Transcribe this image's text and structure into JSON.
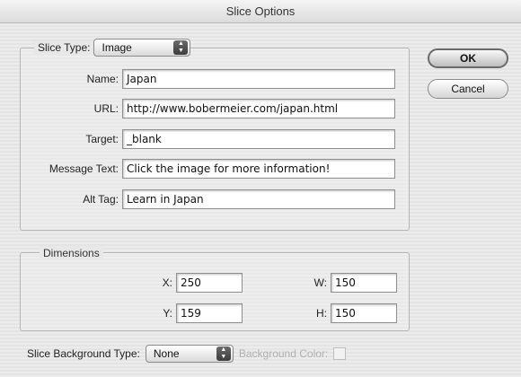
{
  "window": {
    "title": "Slice Options"
  },
  "slice_type": {
    "label": "Slice Type:",
    "value": "Image"
  },
  "fields": {
    "name": {
      "label": "Name:",
      "value": "Japan"
    },
    "url": {
      "label": "URL:",
      "value": "http://www.bobermeier.com/japan.html"
    },
    "target": {
      "label": "Target:",
      "value": "_blank"
    },
    "message": {
      "label": "Message Text:",
      "value": "Click the image for more information!"
    },
    "alt": {
      "label": "Alt Tag:",
      "value": "Learn in Japan"
    }
  },
  "dimensions": {
    "legend": "Dimensions",
    "x": {
      "label": "X:",
      "value": "250"
    },
    "y": {
      "label": "Y:",
      "value": "159"
    },
    "w": {
      "label": "W:",
      "value": "150"
    },
    "h": {
      "label": "H:",
      "value": "150"
    }
  },
  "background": {
    "type_label": "Slice Background Type:",
    "type_value": "None",
    "color_label": "Background Color:"
  },
  "buttons": {
    "ok": "OK",
    "cancel": "Cancel"
  }
}
